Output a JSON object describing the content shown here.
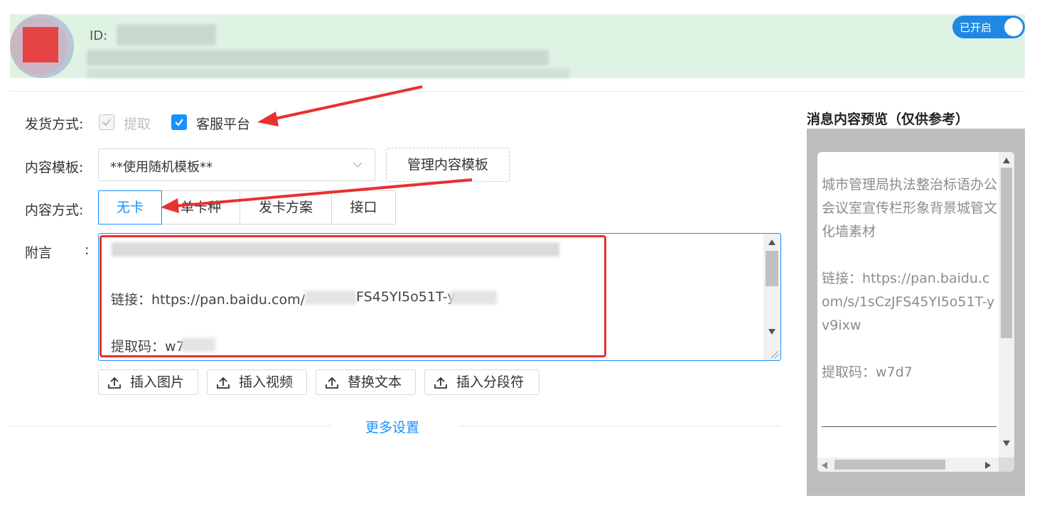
{
  "header": {
    "id_label": "ID:",
    "toggle_label": "已开启"
  },
  "form": {
    "delivery": {
      "label": "发货方式:",
      "option_extract": "提取",
      "option_service": "客服平台"
    },
    "template": {
      "label": "内容模板:",
      "selected": "**使用随机模板**",
      "manage_button": "管理内容模板"
    },
    "content_mode": {
      "label": "内容方式:",
      "options": [
        "无卡",
        "单卡种",
        "发卡方案",
        "接口"
      ],
      "active": "无卡"
    },
    "note": {
      "label": "附言",
      "colon": ":",
      "line_link": "链接：https://pan.baidu.com/",
      "line_link_tail": "FS45YI5o51T-y",
      "line_code": "提取码：w7"
    },
    "toolbar": {
      "insert_image": "插入图片",
      "insert_video": "插入视频",
      "replace_text": "替换文本",
      "insert_separator": "插入分段符"
    },
    "more_settings": "更多设置"
  },
  "preview": {
    "title": "消息内容预览（仅供参考）",
    "body_text": "城市管理局执法整治标语办公会议室宣传栏形象背景城管文化墙素材",
    "link_text": "链接：https://pan.baidu.com/s/1sCzJFS45YI5o51T-yv9ixw",
    "code_text": "提取码：w7d7"
  },
  "colors": {
    "accent": "#1890ff",
    "header_bg": "#dff3e4",
    "annotation_red": "#e8312e"
  }
}
